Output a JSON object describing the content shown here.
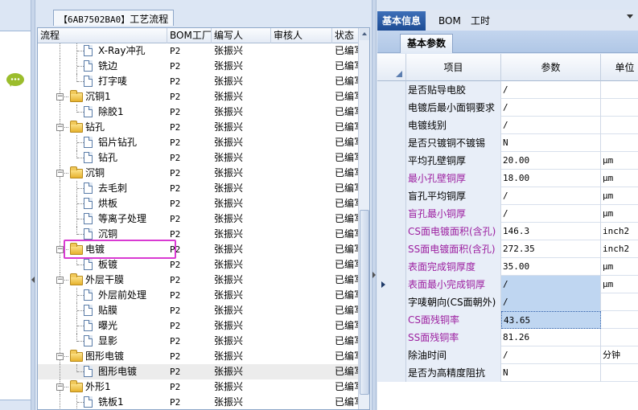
{
  "center_tab": {
    "code": "【6AB7502BA0】",
    "title": "工艺流程"
  },
  "tree_headers": [
    "流程",
    "BOM工厂",
    "编写人",
    "审核人",
    "状态"
  ],
  "tree_rows": [
    {
      "name": "X-Ray冲孔",
      "level": 2,
      "type": "doc",
      "bom": "P2",
      "writer": "张振兴",
      "status": "已编写",
      "last": false
    },
    {
      "name": "铣边",
      "level": 2,
      "type": "doc",
      "bom": "P2",
      "writer": "张振兴",
      "status": "已编写",
      "last": false
    },
    {
      "name": "打字唛",
      "level": 2,
      "type": "doc",
      "bom": "P2",
      "writer": "张振兴",
      "status": "已编写",
      "last": true
    },
    {
      "name": "沉铜1",
      "level": 1,
      "type": "folder",
      "bom": "P2",
      "writer": "张振兴",
      "status": "已编写"
    },
    {
      "name": "除胶1",
      "level": 2,
      "type": "doc",
      "bom": "P2",
      "writer": "张振兴",
      "status": "已编写",
      "last": true
    },
    {
      "name": "钻孔",
      "level": 1,
      "type": "folder",
      "bom": "P2",
      "writer": "张振兴",
      "status": "已编写"
    },
    {
      "name": "铝片钻孔",
      "level": 2,
      "type": "doc",
      "bom": "P2",
      "writer": "张振兴",
      "status": "已编写",
      "last": false
    },
    {
      "name": "钻孔",
      "level": 2,
      "type": "doc",
      "bom": "P2",
      "writer": "张振兴",
      "status": "已编写",
      "last": true
    },
    {
      "name": "沉铜",
      "level": 1,
      "type": "folder",
      "bom": "P2",
      "writer": "张振兴",
      "status": "已编写"
    },
    {
      "name": "去毛刺",
      "level": 2,
      "type": "doc",
      "bom": "P2",
      "writer": "张振兴",
      "status": "已编写",
      "last": false
    },
    {
      "name": "烘板",
      "level": 2,
      "type": "doc",
      "bom": "P2",
      "writer": "张振兴",
      "status": "已编写",
      "last": false
    },
    {
      "name": "等离子处理",
      "level": 2,
      "type": "doc",
      "bom": "P2",
      "writer": "张振兴",
      "status": "已编写",
      "last": false
    },
    {
      "name": "沉铜",
      "level": 2,
      "type": "doc",
      "bom": "P2",
      "writer": "张振兴",
      "status": "已编写",
      "last": true
    },
    {
      "name": "电镀",
      "level": 1,
      "type": "folder",
      "bom": "P2",
      "writer": "张振兴",
      "status": "已编写"
    },
    {
      "name": "板镀",
      "level": 2,
      "type": "doc",
      "bom": "P2",
      "writer": "张振兴",
      "status": "已编写",
      "last": true
    },
    {
      "name": "外层干膜",
      "level": 1,
      "type": "folder",
      "bom": "P2",
      "writer": "张振兴",
      "status": "已编写"
    },
    {
      "name": "外层前处理",
      "level": 2,
      "type": "doc",
      "bom": "P2",
      "writer": "张振兴",
      "status": "已编写",
      "last": false
    },
    {
      "name": "贴膜",
      "level": 2,
      "type": "doc",
      "bom": "P2",
      "writer": "张振兴",
      "status": "已编写",
      "last": false
    },
    {
      "name": "曝光",
      "level": 2,
      "type": "doc",
      "bom": "P2",
      "writer": "张振兴",
      "status": "已编写",
      "last": false
    },
    {
      "name": "显影",
      "level": 2,
      "type": "doc",
      "bom": "P2",
      "writer": "张振兴",
      "status": "已编写",
      "last": true
    },
    {
      "name": "图形电镀",
      "level": 1,
      "type": "folder",
      "bom": "P2",
      "writer": "张振兴",
      "status": "已编写"
    },
    {
      "name": "图形电镀",
      "level": 2,
      "type": "doc",
      "bom": "P2",
      "writer": "张振兴",
      "status": "已编写",
      "last": true,
      "selected": true
    },
    {
      "name": "外形1",
      "level": 1,
      "type": "folder",
      "bom": "P2",
      "writer": "张振兴",
      "status": "已编写"
    },
    {
      "name": "铣板1",
      "level": 2,
      "type": "doc",
      "bom": "P2",
      "writer": "张振兴",
      "status": "已编写",
      "last": false
    }
  ],
  "right_tabs": [
    "基本信息",
    "BOM",
    "工时"
  ],
  "sub_tab": "基本参数",
  "grid_headers": {
    "item": "项目",
    "param": "参数",
    "unit": "单位"
  },
  "grid_rows": [
    {
      "item": "是否贴导电胶",
      "param": "/",
      "unit": "",
      "purple": false
    },
    {
      "item": "电镀后最小面铜要求",
      "param": "/",
      "unit": "",
      "purple": false
    },
    {
      "item": "电镀线别",
      "param": "/",
      "unit": "",
      "purple": false
    },
    {
      "item": "是否只镀铜不镀锡",
      "param": "N",
      "unit": "",
      "purple": false
    },
    {
      "item": "平均孔壁铜厚",
      "param": "20.00",
      "unit": "μm",
      "purple": false
    },
    {
      "item": "最小孔壁铜厚",
      "param": "18.00",
      "unit": "μm",
      "purple": true
    },
    {
      "item": "盲孔平均铜厚",
      "param": "/",
      "unit": "μm",
      "purple": false
    },
    {
      "item": "盲孔最小铜厚",
      "param": "/",
      "unit": "μm",
      "purple": true
    },
    {
      "item": "CS面电镀面积(含孔)",
      "param": "146.3",
      "unit": "inch2",
      "purple": true
    },
    {
      "item": "SS面电镀面积(含孔)",
      "param": "272.35",
      "unit": "inch2",
      "purple": true
    },
    {
      "item": "表面完成铜厚度",
      "param": "35.00",
      "unit": "μm",
      "purple": true
    },
    {
      "item": "表面最小完成铜厚",
      "param": "/",
      "unit": "μm",
      "purple": true,
      "current": true,
      "hl": true
    },
    {
      "item": "字唛朝向(CS面朝外)",
      "param": "/",
      "unit": "",
      "purple": false,
      "hl": true
    },
    {
      "item": "CS面残铜率",
      "param": "43.65",
      "unit": "",
      "purple": true,
      "focus": true
    },
    {
      "item": "SS面残铜率",
      "param": "81.26",
      "unit": "",
      "purple": true
    },
    {
      "item": "除油时间",
      "param": "/",
      "unit": "分钟",
      "purple": false
    },
    {
      "item": "是否为高精度阻抗",
      "param": "N",
      "unit": "",
      "purple": false
    }
  ]
}
